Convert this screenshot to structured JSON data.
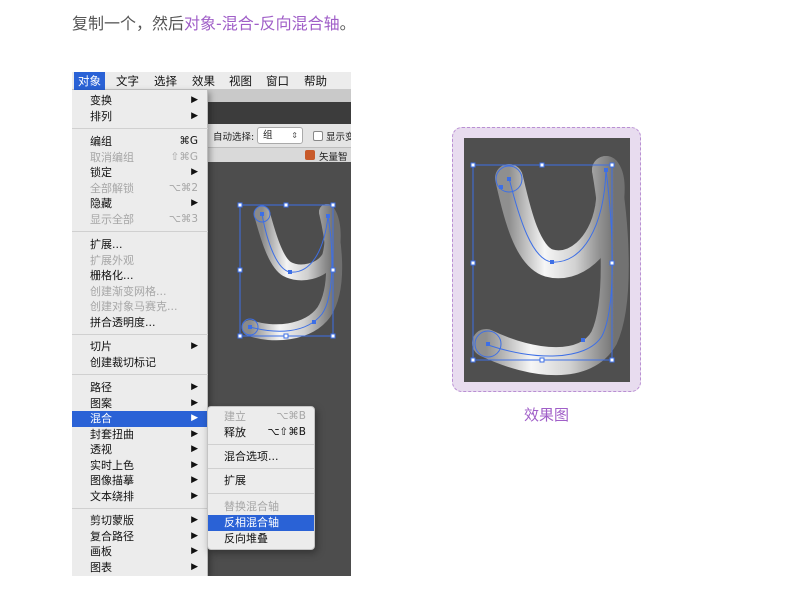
{
  "instruction": {
    "prefix": "复制一个，然后",
    "highlight": "对象-混合-反向混合轴",
    "suffix": "。"
  },
  "menubar": [
    "对象",
    "文字",
    "选择",
    "效果",
    "视图",
    "窗口",
    "帮助"
  ],
  "app": {
    "auto_select_label": "自动选择:",
    "auto_select_value": "组",
    "show_label": "显示变",
    "tab_label": "矢量智"
  },
  "menu": {
    "items": [
      {
        "label": "变换",
        "shortcut": "",
        "submenu": true,
        "disabled": false
      },
      {
        "label": "排列",
        "shortcut": "",
        "submenu": true,
        "disabled": false
      },
      {
        "label": "编组",
        "shortcut": "⌘G",
        "submenu": false,
        "disabled": false
      },
      {
        "label": "取消编组",
        "shortcut": "⇧⌘G",
        "submenu": false,
        "disabled": true
      },
      {
        "label": "锁定",
        "shortcut": "",
        "submenu": true,
        "disabled": false
      },
      {
        "label": "全部解锁",
        "shortcut": "⌥⌘2",
        "submenu": false,
        "disabled": true
      },
      {
        "label": "隐藏",
        "shortcut": "",
        "submenu": true,
        "disabled": false
      },
      {
        "label": "显示全部",
        "shortcut": "⌥⌘3",
        "submenu": false,
        "disabled": true
      },
      {
        "label": "扩展...",
        "shortcut": "",
        "submenu": false,
        "disabled": false
      },
      {
        "label": "扩展外观",
        "shortcut": "",
        "submenu": false,
        "disabled": true
      },
      {
        "label": "栅格化...",
        "shortcut": "",
        "submenu": false,
        "disabled": false
      },
      {
        "label": "创建渐变网格...",
        "shortcut": "",
        "submenu": false,
        "disabled": true
      },
      {
        "label": "创建对象马赛克...",
        "shortcut": "",
        "submenu": false,
        "disabled": true
      },
      {
        "label": "拼合透明度...",
        "shortcut": "",
        "submenu": false,
        "disabled": false
      },
      {
        "label": "切片",
        "shortcut": "",
        "submenu": true,
        "disabled": false
      },
      {
        "label": "创建裁切标记",
        "shortcut": "",
        "submenu": false,
        "disabled": false
      },
      {
        "label": "路径",
        "shortcut": "",
        "submenu": true,
        "disabled": false
      },
      {
        "label": "图案",
        "shortcut": "",
        "submenu": true,
        "disabled": false
      },
      {
        "label": "混合",
        "shortcut": "",
        "submenu": true,
        "disabled": false,
        "selected": true
      },
      {
        "label": "封套扭曲",
        "shortcut": "",
        "submenu": true,
        "disabled": false
      },
      {
        "label": "透视",
        "shortcut": "",
        "submenu": true,
        "disabled": false
      },
      {
        "label": "实时上色",
        "shortcut": "",
        "submenu": true,
        "disabled": false
      },
      {
        "label": "图像描摹",
        "shortcut": "",
        "submenu": true,
        "disabled": false
      },
      {
        "label": "文本绕排",
        "shortcut": "",
        "submenu": true,
        "disabled": false
      },
      {
        "label": "剪切蒙版",
        "shortcut": "",
        "submenu": true,
        "disabled": false
      },
      {
        "label": "复合路径",
        "shortcut": "",
        "submenu": true,
        "disabled": false
      },
      {
        "label": "画板",
        "shortcut": "",
        "submenu": true,
        "disabled": false
      },
      {
        "label": "图表",
        "shortcut": "",
        "submenu": true,
        "disabled": false
      }
    ],
    "submenu_arrow": "▶"
  },
  "submenu": {
    "items": [
      {
        "label": "建立",
        "shortcut": "⌥⌘B",
        "disabled": true
      },
      {
        "label": "释放",
        "shortcut": "⌥⇧⌘B",
        "disabled": false
      },
      {
        "label": "混合选项...",
        "shortcut": "",
        "disabled": false
      },
      {
        "label": "扩展",
        "shortcut": "",
        "disabled": false
      },
      {
        "label": "替换混合轴",
        "shortcut": "",
        "disabled": true
      },
      {
        "label": "反相混合轴",
        "shortcut": "",
        "disabled": false,
        "selected": true
      },
      {
        "label": "反向堆叠",
        "shortcut": "",
        "disabled": false
      }
    ]
  },
  "result_caption": "效果图",
  "colors": {
    "highlight": "#a05fc8",
    "menu_selected": "#2a62d6",
    "canvas": "#4d4d4d",
    "selection": "#3d6fe6",
    "result_panel": "#e8dcef"
  }
}
